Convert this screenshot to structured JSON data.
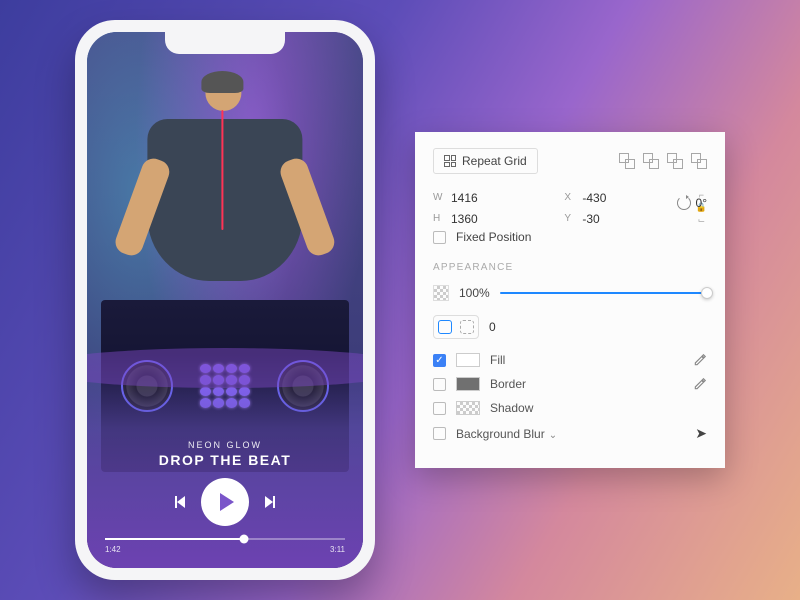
{
  "phone": {
    "artist": "NEON GLOW",
    "title": "DROP THE BEAT",
    "time_current": "1:42",
    "time_total": "3:11"
  },
  "panel": {
    "repeat_grid": "Repeat Grid",
    "w_label": "W",
    "w_value": "1416",
    "h_label": "H",
    "h_value": "1360",
    "x_label": "X",
    "x_value": "-430",
    "y_label": "Y",
    "y_value": "-30",
    "rotation": "0°",
    "fixed_position": "Fixed Position",
    "appearance": "APPEARANCE",
    "opacity": "100%",
    "corner_radius": "0",
    "fill": "Fill",
    "border": "Border",
    "shadow": "Shadow",
    "bg_blur": "Background Blur"
  }
}
